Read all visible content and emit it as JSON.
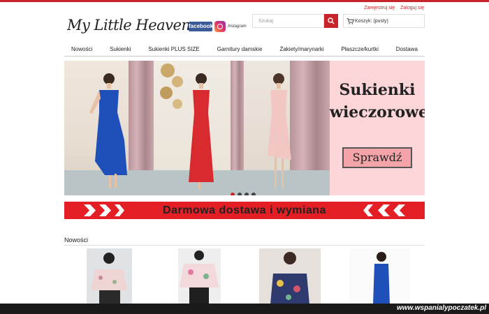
{
  "top_links": {
    "register": "Zarejestruj się",
    "login": "Zaloguj się"
  },
  "brand": {
    "logo_text": "My Little Heaven",
    "facebook": "facebook",
    "instagram": "Instagram"
  },
  "search": {
    "placeholder": "Szukaj"
  },
  "cart": {
    "label": "Koszyk: (pusty)"
  },
  "nav": [
    "Nowości",
    "Sukienki",
    "Sukienki PLUS SIZE",
    "Garnitury damskie",
    "Żakiety/marynarki",
    "Płaszcze/kurtki",
    "Dostawa"
  ],
  "hero": {
    "title_line1": "Sukienki",
    "title_line2": "wieczorowe",
    "cta": "Sprawdź",
    "slides": 4,
    "active_slide": 1
  },
  "banner": {
    "text": "Darmowa dostawa i wymiana"
  },
  "section": {
    "title": "Nowości"
  },
  "watermark": "www.wspanialypoczatek.pl",
  "colors": {
    "accent": "#c8242b",
    "banner": "#e31e24",
    "hero_pink": "#fbd5d8",
    "cta_pink": "#f4a3a8"
  }
}
